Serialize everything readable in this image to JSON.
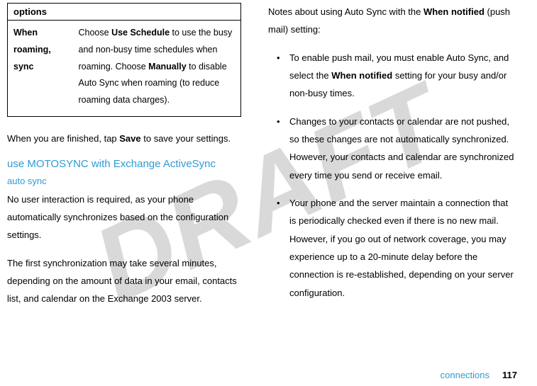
{
  "watermark": "DRAFT",
  "table": {
    "header": "options",
    "row1_key_line1": "When roaming,",
    "row1_key_line2": "sync",
    "row1_val_p1a": "Choose ",
    "row1_val_p1b": "Use Schedule",
    "row1_val_p1c": " to use the busy and non-busy time schedules when roaming. Choose ",
    "row1_val_p1d": "Manually",
    "row1_val_p1e": " to disable Auto Sync when roaming (to reduce roaming data charges)."
  },
  "left": {
    "p1a": "When you are finished, tap ",
    "p1b": "Save",
    "p1c": " to save your settings.",
    "h2": "use MOTOSYNC with Exchange ActiveSync",
    "h3": "auto sync",
    "p2": "No user interaction is required, as your phone automatically synchronizes based on the configuration settings.",
    "p3": "The first synchronization may take several minutes, depending on the amount of data in your email, contacts list, and calendar on the Exchange 2003 server."
  },
  "right": {
    "intro_a": "Notes about using Auto Sync with the ",
    "intro_b": "When notified",
    "intro_c": " (push mail) setting:",
    "b1a": "To enable push mail, you must enable Auto Sync, and select the ",
    "b1b": "When notified",
    "b1c": " setting for your busy and/or non-busy times.",
    "b2": "Changes to your contacts or calendar are not pushed, so these changes are not automatically synchronized. However, your contacts and calendar are synchronized every time you send or receive email.",
    "b3": "Your phone and the server maintain a connection that is periodically checked even if there is no new mail. However, if you go out of network coverage, you may experience up to a 20-minute delay before the connection is re-established, depending on your server configuration."
  },
  "footer": {
    "label": "connections",
    "page": "117"
  }
}
